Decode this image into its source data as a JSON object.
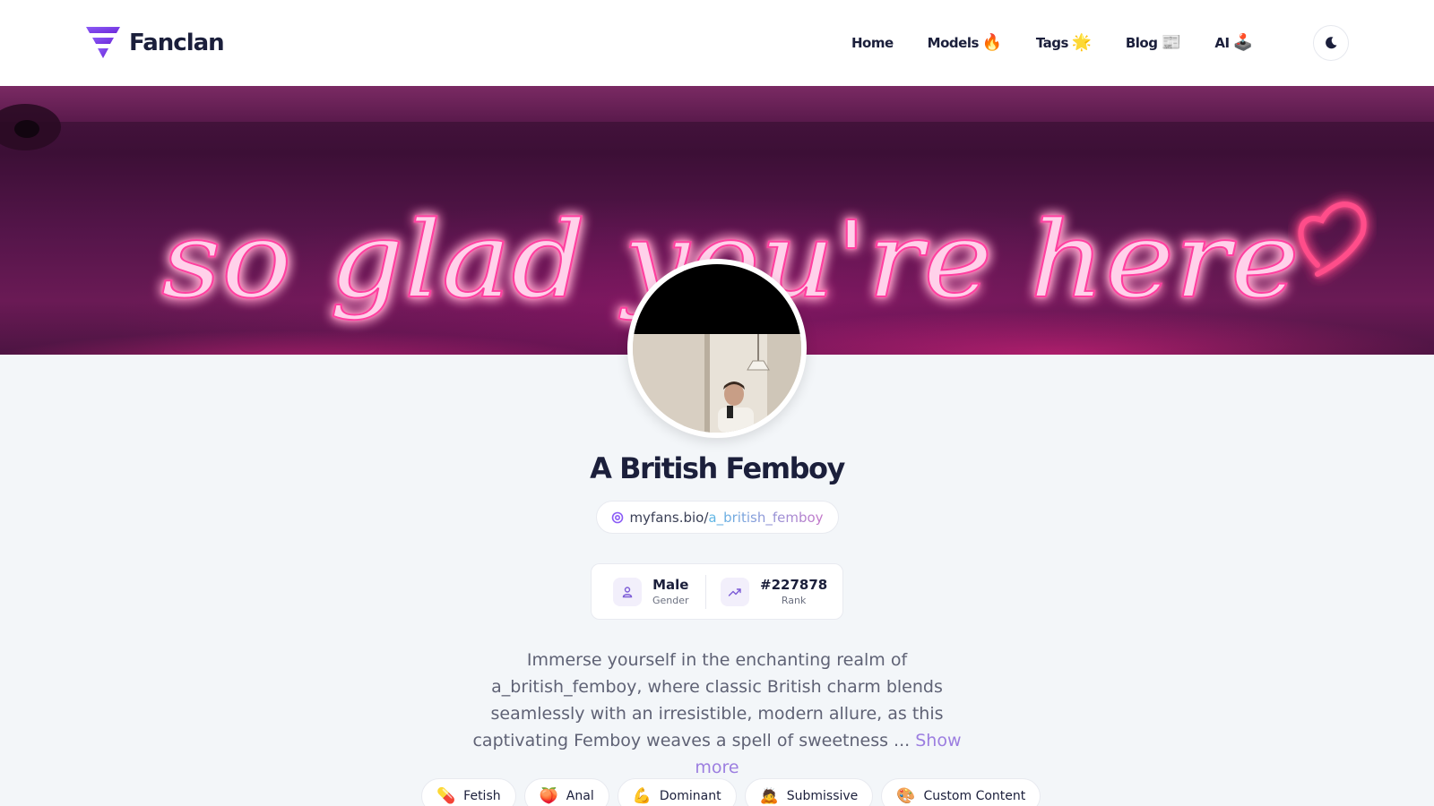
{
  "brand": {
    "name": "Fanclan",
    "accent": "#7c4dff"
  },
  "nav": {
    "items": [
      {
        "label": "Home",
        "emoji": ""
      },
      {
        "label": "Models",
        "emoji": "🔥"
      },
      {
        "label": "Tags",
        "emoji": "🌟"
      },
      {
        "label": "Blog",
        "emoji": "📰"
      },
      {
        "label": "AI",
        "emoji": "🕹️"
      }
    ],
    "theme_icon": "moon-icon"
  },
  "banner": {
    "neon_text": "so glad you're here"
  },
  "profile": {
    "name": "A British Femboy",
    "handle_prefix": "myfans.bio/",
    "handle_name": "a_british_femboy",
    "stats": {
      "gender_value": "Male",
      "gender_label": "Gender",
      "rank_value": "#227878",
      "rank_label": "Rank"
    },
    "bio": "Immerse yourself in the enchanting realm of a_british_femboy, where classic British charm blends seamlessly with an irresistible, modern allure, as this captivating Femboy weaves a spell of sweetness ...",
    "show_more": "Show more"
  },
  "tags": [
    {
      "emoji": "💊",
      "label": "Fetish"
    },
    {
      "emoji": "🍑",
      "label": "Anal"
    },
    {
      "emoji": "💪",
      "label": "Dominant"
    },
    {
      "emoji": "🙇",
      "label": "Submissive"
    },
    {
      "emoji": "🎨",
      "label": "Custom Content"
    }
  ]
}
